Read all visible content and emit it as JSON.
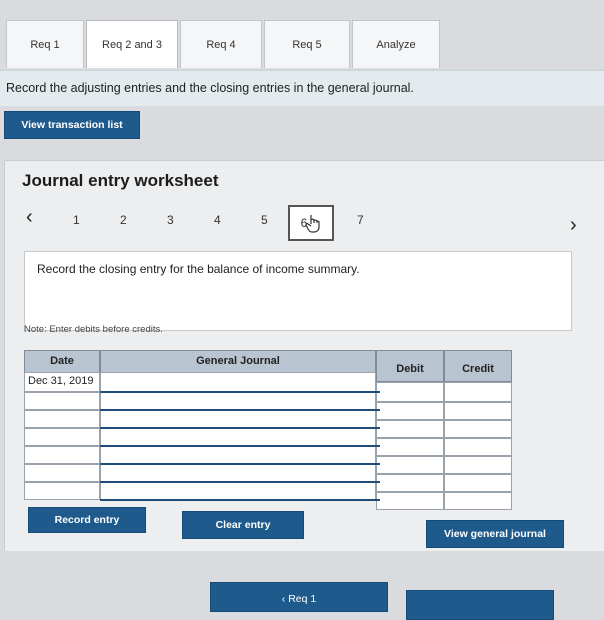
{
  "tabs": [
    {
      "label": "Req 1"
    },
    {
      "label": "Req 2 and 3"
    },
    {
      "label": "Req 4"
    },
    {
      "label": "Req 5"
    },
    {
      "label": "Analyze"
    }
  ],
  "instruction": "Record the adjusting entries and the closing entries in the general journal.",
  "view_transaction_list": "View transaction list",
  "worksheet_title": "Journal entry worksheet",
  "pager": {
    "prev": "‹",
    "next": "›",
    "pages": [
      "1",
      "2",
      "3",
      "4",
      "5",
      "6",
      "7"
    ],
    "current": "6"
  },
  "entry_instruction": "Record the closing entry for the balance of income summary.",
  "note": "Note: Enter debits before credits.",
  "journal": {
    "headers": {
      "date": "Date",
      "general_journal": "General Journal",
      "debit": "Debit",
      "credit": "Credit"
    },
    "rows": [
      {
        "date": "Dec 31, 2019",
        "account": "",
        "debit": "",
        "credit": ""
      },
      {
        "date": "",
        "account": "",
        "debit": "",
        "credit": ""
      },
      {
        "date": "",
        "account": "",
        "debit": "",
        "credit": ""
      },
      {
        "date": "",
        "account": "",
        "debit": "",
        "credit": ""
      },
      {
        "date": "",
        "account": "",
        "debit": "",
        "credit": ""
      },
      {
        "date": "",
        "account": "",
        "debit": "",
        "credit": ""
      },
      {
        "date": "",
        "account": "",
        "debit": "",
        "credit": ""
      }
    ]
  },
  "buttons": {
    "record": "Record entry",
    "clear": "Clear entry",
    "view_journal": "View general journal"
  },
  "bottom_nav": {
    "prev_label": "‹ Req 1"
  },
  "colors": {
    "primary_button": "#1f5a8c",
    "header_row": "#b8c4cf",
    "instruction_bar": "#e3ebef"
  }
}
